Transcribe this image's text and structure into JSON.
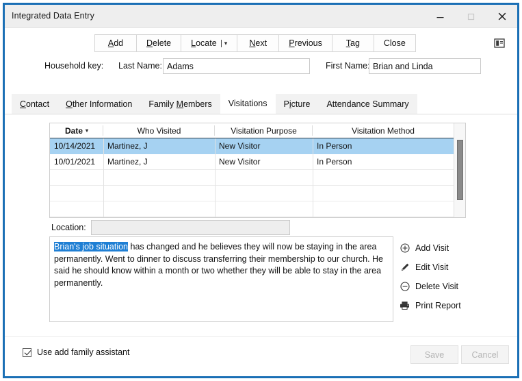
{
  "window": {
    "title": "Integrated Data Entry",
    "controls": {
      "minimize": "minimize-icon",
      "maximize": "maximize-icon",
      "close": "close-icon"
    },
    "accent_border": "#1a6fb5",
    "titlebar_bg": "#eeeeee"
  },
  "toolbar": {
    "buttons": [
      {
        "label": "Add",
        "accel": "A"
      },
      {
        "label": "Delete",
        "accel": "D"
      },
      {
        "label": "Locate",
        "accel": "L",
        "split": true,
        "chevron": "chevron-down-icon"
      },
      {
        "label": "Next",
        "accel": "N"
      },
      {
        "label": "Previous",
        "accel": "P"
      },
      {
        "label": "Tag",
        "accel": "T"
      },
      {
        "label": "Close",
        "accel": ""
      }
    ],
    "panel_toggle_icon": "panel-layout-icon"
  },
  "household": {
    "group_label": "Household key:",
    "last_name_label": "Last Name:",
    "last_name_value": "Adams",
    "first_name_label": "First Name:",
    "first_name_value": "Brian and Linda"
  },
  "tabs": {
    "items": [
      {
        "label": "Contact",
        "accel": "C",
        "active": false
      },
      {
        "label": "Other Information",
        "accel": "O",
        "active": false
      },
      {
        "label": "Family Members",
        "accel": "M",
        "active": false
      },
      {
        "label": "Visitations",
        "accel": "",
        "active": true
      },
      {
        "label": "Picture",
        "accel": "i",
        "active": false
      },
      {
        "label": "Attendance Summary",
        "accel": "",
        "active": false
      }
    ],
    "selected": "Visitations"
  },
  "grid": {
    "columns": [
      "Date",
      "Who Visited",
      "Visitation Purpose",
      "Visitation Method"
    ],
    "sort_column": "Date",
    "sort_indicator": "chevron-down-icon",
    "selection_color": "#a6d2f2",
    "rows": [
      {
        "date": "10/14/2021",
        "who": "Martinez, J",
        "purpose": "New Visitor",
        "method": "In Person",
        "selected": true
      },
      {
        "date": "10/01/2021",
        "who": "Martinez, J",
        "purpose": "New Visitor",
        "method": "In Person",
        "selected": false
      },
      {
        "date": "",
        "who": "",
        "purpose": "",
        "method": "",
        "selected": false
      },
      {
        "date": "",
        "who": "",
        "purpose": "",
        "method": "",
        "selected": false
      },
      {
        "date": "",
        "who": "",
        "purpose": "",
        "method": "",
        "selected": false
      }
    ],
    "scrollbar": "vertical-scrollbar"
  },
  "location": {
    "label": "Location:",
    "value": "",
    "placeholder": ""
  },
  "notes": {
    "selected_text": "Brian's job situation",
    "rest_text": " has changed and he believes they will now be staying in the area permanently.  Went to dinner to discuss transferring their membership to our church. He said he should know within a month or two whether they will be able to stay in the area permanently.",
    "selection_color": "#1f7fd4"
  },
  "actions": [
    {
      "label": "Add Visit",
      "icon": "plus-circle-icon"
    },
    {
      "label": "Edit Visit",
      "icon": "pencil-icon"
    },
    {
      "label": "Delete Visit",
      "icon": "minus-circle-icon"
    },
    {
      "label": "Print Report",
      "icon": "printer-icon"
    }
  ],
  "footer": {
    "checkbox_label": "Use add family assistant",
    "checkbox_checked": true,
    "save_label": "Save",
    "cancel_label": "Cancel",
    "buttons_disabled": true
  }
}
